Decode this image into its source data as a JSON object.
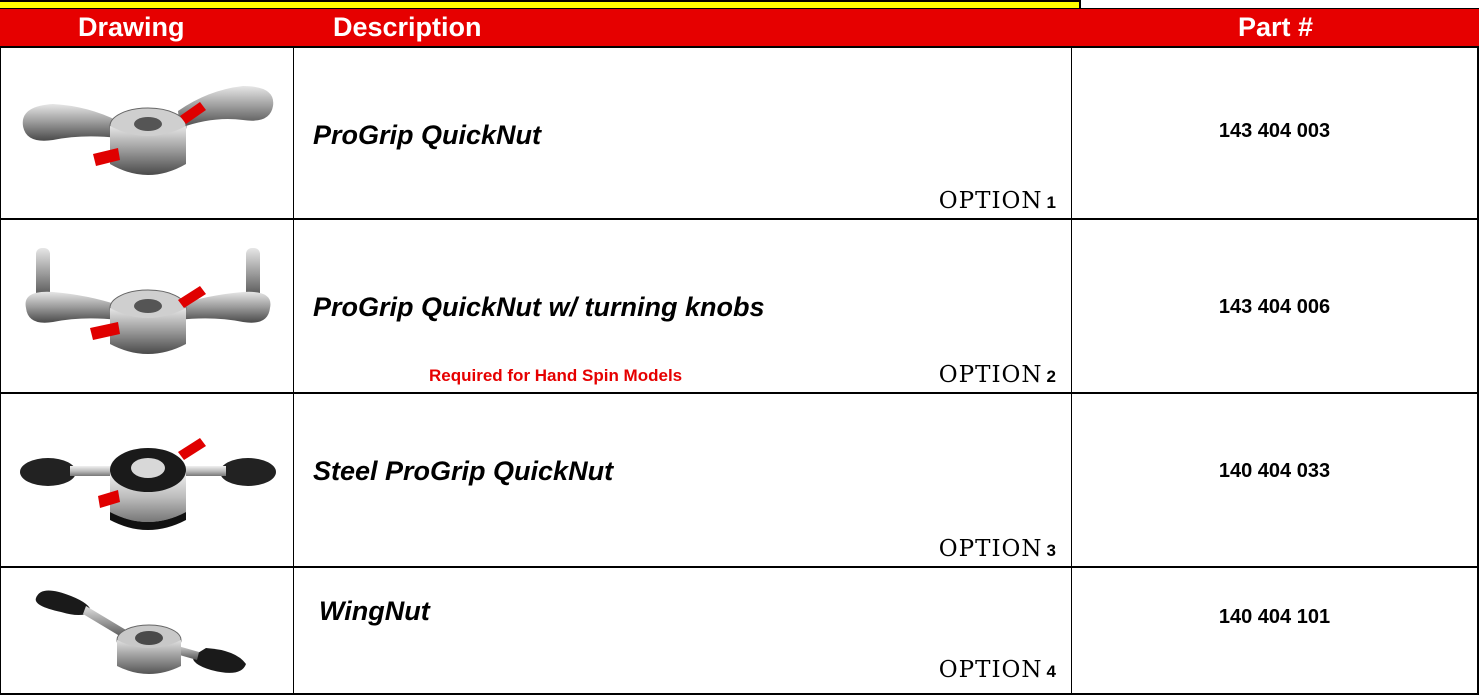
{
  "header": {
    "drawing_label": "Drawing",
    "description_label": "Description",
    "part_label": "Part #"
  },
  "colors": {
    "header_bg": "#e60000",
    "header_text": "#ffffff",
    "top_accent": "#ffff00",
    "note_text": "#e60000"
  },
  "rows": [
    {
      "description": "ProGrip QuickNut",
      "option_label": "OPTION",
      "option_number": "1",
      "note": "",
      "part_number": "143 404 003",
      "icon": "progrip-quicknut-icon"
    },
    {
      "description": "ProGrip QuickNut w/ turning knobs",
      "option_label": "OPTION",
      "option_number": "2",
      "note": "Required for Hand Spin Models",
      "part_number": "143 404 006",
      "icon": "progrip-quicknut-knobs-icon"
    },
    {
      "description": "Steel ProGrip QuickNut",
      "option_label": "OPTION",
      "option_number": "3",
      "note": "",
      "part_number": "140 404 033",
      "icon": "steel-progrip-quicknut-icon"
    },
    {
      "description": "WingNut",
      "option_label": "OPTION",
      "option_number": "4",
      "note": "",
      "part_number": "140 404 101",
      "icon": "wingnut-icon"
    }
  ]
}
